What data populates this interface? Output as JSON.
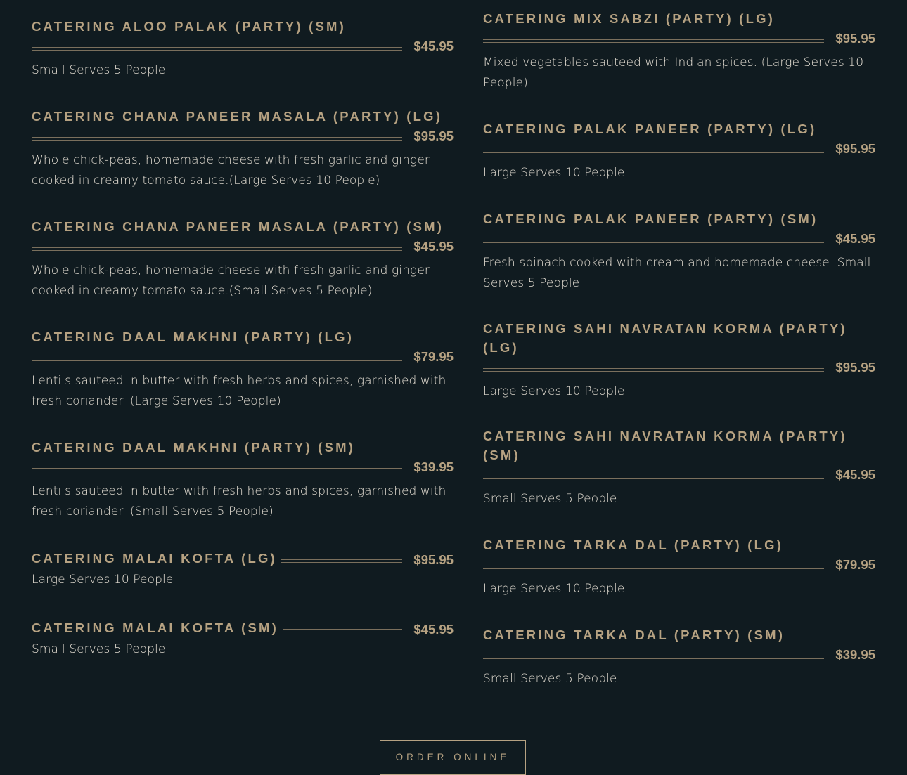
{
  "left_items": [
    {
      "name": "CATERING ALOO PALAK (PARTY) (SM)",
      "price": "$45.95",
      "desc": "Small Serves 5 People"
    },
    {
      "name": "CATERING CHANA PANEER MASALA (PARTY) (LG)",
      "price": "$95.95",
      "desc": "Whole chick-peas, homemade cheese with fresh garlic and ginger cooked in creamy tomato sauce.(Large Serves 10 People)"
    },
    {
      "name": "CATERING CHANA PANEER MASALA (PARTY) (SM)",
      "price": "$45.95",
      "desc": "Whole chick-peas, homemade cheese with fresh garlic and ginger cooked in creamy tomato sauce.(Small Serves 5 People)"
    },
    {
      "name": "CATERING DAAL MAKHNI (PARTY) (LG)",
      "price": "$79.95",
      "desc": "Lentils sauteed in butter with fresh herbs and spices, garnished with fresh coriander. (Large Serves 10 People)"
    },
    {
      "name": "CATERING DAAL MAKHNI (PARTY) (SM)",
      "price": "$39.95",
      "desc": "Lentils sauteed in butter with fresh herbs and spices, garnished with fresh coriander. (Small Serves 5 People)"
    },
    {
      "name": "CATERING MALAI KOFTA (LG)",
      "price": "$95.95",
      "desc": "Large Serves 10 People"
    },
    {
      "name": "CATERING MALAI KOFTA (SM)",
      "price": "$45.95",
      "desc": "Small Serves 5 People"
    }
  ],
  "right_items": [
    {
      "name": "CATERING MIX SABZI (PARTY) (LG)",
      "price": "$95.95",
      "desc": "Mixed vegetables sauteed with Indian spices. (Large Serves 10 People)"
    },
    {
      "name": "CATERING PALAK PANEER (PARTY) (LG)",
      "price": "$95.95",
      "desc": "Large Serves 10 People"
    },
    {
      "name": "CATERING PALAK PANEER (PARTY) (SM)",
      "price": "$45.95",
      "desc": "Fresh spinach cooked with cream and homemade cheese. Small Serves 5 People"
    },
    {
      "name": "CATERING SAHI NAVRATAN KORMA (PARTY) (LG)",
      "price": "$95.95",
      "desc": "Large Serves 10 People"
    },
    {
      "name": "CATERING SAHI NAVRATAN KORMA (PARTY) (SM)",
      "price": "$45.95",
      "desc": "Small Serves 5 People"
    },
    {
      "name": "CATERING TARKA DAL (PARTY) (LG)",
      "price": "$79.95",
      "desc": "Large Serves 10 People"
    },
    {
      "name": "CATERING TARKA DAL (PARTY) (SM)",
      "price": "$39.95",
      "desc": "Small Serves 5 People"
    }
  ],
  "order_button": {
    "label": "ORDER ONLINE"
  }
}
